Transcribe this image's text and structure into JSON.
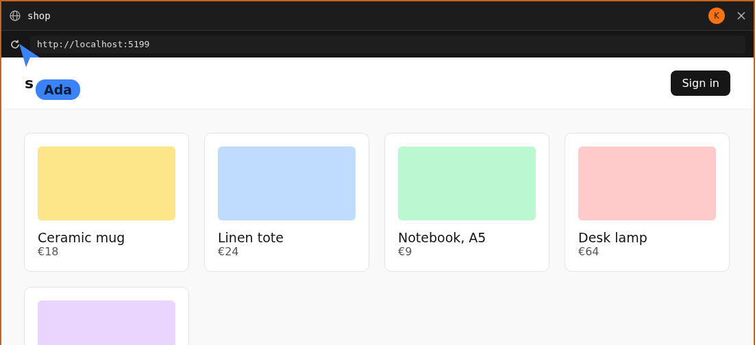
{
  "window": {
    "title": "shop",
    "avatar": "K"
  },
  "address_bar": {
    "url": "http://localhost:5199"
  },
  "header": {
    "site_title": "s",
    "sign_in": "Sign in"
  },
  "cursor": {
    "label": "Ada"
  },
  "products": [
    {
      "name": "Ceramic mug",
      "price": "€18",
      "color": "#fde68a"
    },
    {
      "name": "Linen tote",
      "price": "€24",
      "color": "#bfdbfe"
    },
    {
      "name": "Notebook, A5",
      "price": "€9",
      "color": "#bbf7d0"
    },
    {
      "name": "Desk lamp",
      "price": "€64",
      "color": "#fecaca"
    },
    {
      "color": "#e9d5ff"
    }
  ]
}
